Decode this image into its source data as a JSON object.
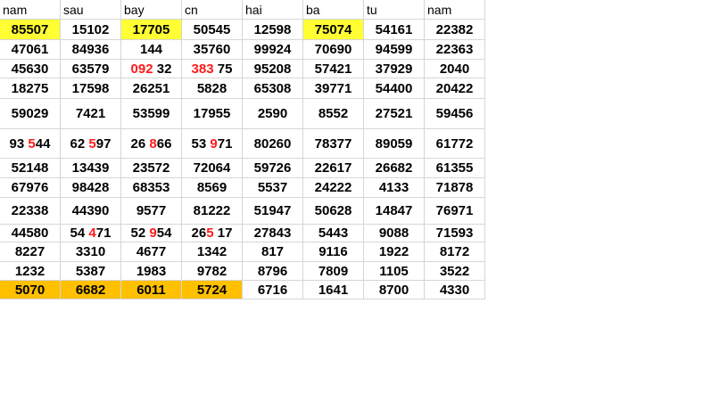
{
  "headers": [
    "nam",
    "sau",
    "bay",
    "cn",
    "hai",
    "ba",
    "tu",
    "nam"
  ],
  "rows": [
    [
      {
        "t": "85507",
        "bg": "yellow"
      },
      {
        "t": "15102"
      },
      {
        "t": "17705",
        "bg": "yellow"
      },
      {
        "t": "50545"
      },
      {
        "t": "12598"
      },
      {
        "t": "75074",
        "bg": "yellow",
        "red": true
      },
      {
        "t": "54161",
        "red": true
      },
      {
        "t": "22382",
        "red": true
      }
    ],
    [
      {
        "t": "47061"
      },
      {
        "t": "84936"
      },
      {
        "t": "144"
      },
      {
        "t": "35760"
      },
      {
        "t": "99924"
      },
      {
        "t": "70690"
      },
      {
        "t": "94599"
      },
      {
        "t": "22363"
      }
    ],
    [
      {
        "t": "45630"
      },
      {
        "t": "63579"
      },
      {
        "parts": [
          {
            "t": "092",
            "red": true
          },
          {
            "t": " 32"
          }
        ]
      },
      {
        "parts": [
          {
            "t": "383",
            "red": true
          },
          {
            "t": " 75"
          }
        ]
      },
      {
        "t": "95208"
      },
      {
        "t": "57421"
      },
      {
        "t": "37929"
      },
      {
        "t": "2040"
      }
    ],
    [
      {
        "t": "18275"
      },
      {
        "t": "17598"
      },
      {
        "t": "26251"
      },
      {
        "t": "5828"
      },
      {
        "t": "65308"
      },
      {
        "t": "39771"
      },
      {
        "t": "54400"
      },
      {
        "t": "20422"
      }
    ],
    [
      {
        "t": "59029"
      },
      {
        "t": "7421"
      },
      {
        "t": "53599"
      },
      {
        "t": "17955"
      },
      {
        "t": "2590"
      },
      {
        "t": "8552"
      },
      {
        "t": "27521"
      },
      {
        "t": "59456"
      }
    ],
    [
      {
        "parts": [
          {
            "t": "93 "
          },
          {
            "t": "5",
            "red": true
          },
          {
            "t": "44"
          }
        ]
      },
      {
        "parts": [
          {
            "t": "62 "
          },
          {
            "t": "5",
            "red": true
          },
          {
            "t": "97"
          }
        ]
      },
      {
        "parts": [
          {
            "t": "26 "
          },
          {
            "t": "8",
            "red": true
          },
          {
            "t": "66"
          }
        ]
      },
      {
        "parts": [
          {
            "t": "53 "
          },
          {
            "t": "9",
            "red": true
          },
          {
            "t": "71"
          }
        ]
      },
      {
        "t": "80260"
      },
      {
        "t": "78377"
      },
      {
        "t": "89059"
      },
      {
        "t": "61772"
      }
    ],
    [
      {
        "t": "52148"
      },
      {
        "t": "13439"
      },
      {
        "t": "23572"
      },
      {
        "t": "72064"
      },
      {
        "t": "59726"
      },
      {
        "t": "22617"
      },
      {
        "t": "26682"
      },
      {
        "t": "61355"
      }
    ],
    [
      {
        "t": "67976"
      },
      {
        "t": "98428"
      },
      {
        "t": "68353"
      },
      {
        "t": "8569"
      },
      {
        "t": "5537"
      },
      {
        "t": "24222"
      },
      {
        "t": "4133"
      },
      {
        "t": "71878"
      }
    ],
    [
      {
        "t": "22338"
      },
      {
        "t": "44390"
      },
      {
        "t": "9577"
      },
      {
        "t": "81222"
      },
      {
        "t": "51947"
      },
      {
        "t": "50628"
      },
      {
        "t": "14847"
      },
      {
        "t": "76971"
      }
    ],
    [
      {
        "t": "44580"
      },
      {
        "parts": [
          {
            "t": "54 "
          },
          {
            "t": "4",
            "red": true
          },
          {
            "t": "71"
          }
        ]
      },
      {
        "parts": [
          {
            "t": "52 "
          },
          {
            "t": "9",
            "red": true
          },
          {
            "t": "54"
          }
        ]
      },
      {
        "parts": [
          {
            "t": "26"
          },
          {
            "t": "5",
            "red": true
          },
          {
            "t": " 17"
          }
        ]
      },
      {
        "t": "27843"
      },
      {
        "t": "5443"
      },
      {
        "t": "9088"
      },
      {
        "t": "71593"
      }
    ],
    [
      {
        "t": "8227"
      },
      {
        "t": "3310"
      },
      {
        "t": "4677"
      },
      {
        "t": "1342"
      },
      {
        "t": "817"
      },
      {
        "t": "9116"
      },
      {
        "t": "1922"
      },
      {
        "t": "8172"
      }
    ],
    [
      {
        "t": "1232"
      },
      {
        "t": "5387"
      },
      {
        "t": "1983"
      },
      {
        "t": "9782"
      },
      {
        "t": "8796"
      },
      {
        "t": "7809"
      },
      {
        "t": "1105"
      },
      {
        "t": "3522"
      }
    ],
    [
      {
        "t": "5070",
        "bg": "orange"
      },
      {
        "t": "6682",
        "bg": "orange"
      },
      {
        "t": "6011",
        "bg": "orange"
      },
      {
        "t": "5724",
        "bg": "orange"
      },
      {
        "t": "6716"
      },
      {
        "t": "1641"
      },
      {
        "t": "8700"
      },
      {
        "t": "4330"
      }
    ]
  ],
  "colors": {
    "highlight_yellow": "#ffff33",
    "highlight_orange": "#ffc000",
    "red_text": "#ff1a1a"
  }
}
